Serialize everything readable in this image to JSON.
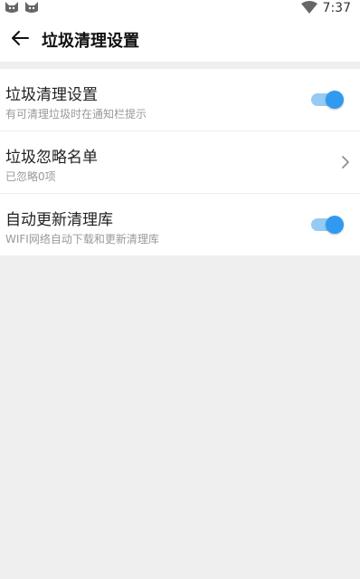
{
  "statusbar": {
    "time": "7:37",
    "left_icons": [
      "cat-notification-icon",
      "cat-notification-icon"
    ],
    "right_icons": [
      "wifi-icon"
    ]
  },
  "appbar": {
    "back_icon": "arrow-left-icon",
    "title": "垃圾清理设置"
  },
  "settings": [
    {
      "title": "垃圾清理设置",
      "subtitle": "有可清理垃圾时在通知栏提示",
      "control": "toggle",
      "checked": true
    },
    {
      "title": "垃圾忽略名单",
      "subtitle": "已忽略0项",
      "control": "chevron"
    },
    {
      "title": "自动更新清理库",
      "subtitle": "WIFI网络自动下载和更新清理库",
      "control": "toggle",
      "checked": true
    }
  ],
  "colors": {
    "accent": "#2f9af0",
    "accent_track": "#94cbf4",
    "background": "#efefef"
  }
}
